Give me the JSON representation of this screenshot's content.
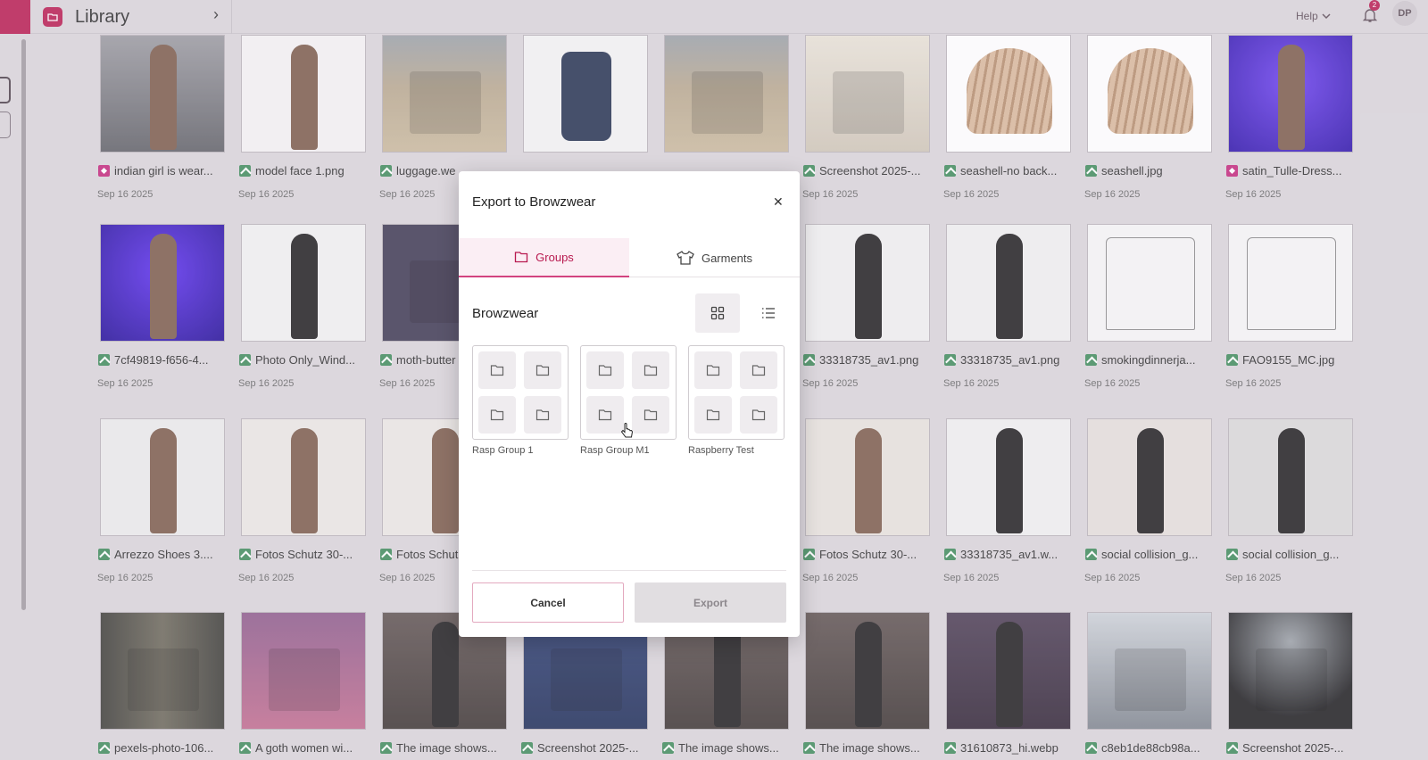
{
  "app": {
    "title": "Library",
    "help_label": "Help",
    "notifications_count": "2",
    "avatar_initials": "DP"
  },
  "grid": {
    "rows": [
      [
        {
          "name": "indian girl is wear...",
          "date": "Sep 16 2025",
          "tag": "pink",
          "thumb": "gym"
        },
        {
          "name": "model face 1.png",
          "date": "Sep 16 2025",
          "tag": "green",
          "thumb": "sport"
        },
        {
          "name": "luggage.we",
          "date": "Sep 16 2025",
          "tag": "green",
          "thumb": "rocks"
        },
        {
          "name": "",
          "date": "",
          "tag": "",
          "thumb": "suitcase"
        },
        {
          "name": "",
          "date": "",
          "tag": "",
          "thumb": "rocks"
        },
        {
          "name": "Screenshot 2025-...",
          "date": "Sep 16 2025",
          "tag": "green",
          "thumb": "room"
        },
        {
          "name": "seashell-no back...",
          "date": "Sep 16 2025",
          "tag": "green",
          "thumb": "shell"
        },
        {
          "name": "seashell.jpg",
          "date": "Sep 16 2025",
          "tag": "green",
          "thumb": "shell"
        },
        {
          "name": "satin_Tulle-Dress...",
          "date": "Sep 16 2025",
          "tag": "pink",
          "thumb": "purple"
        }
      ],
      [
        {
          "name": "7cf49819-f656-4...",
          "date": "Sep 16 2025",
          "tag": "green",
          "thumb": "bluecoat"
        },
        {
          "name": "Photo Only_Wind...",
          "date": "Sep 16 2025",
          "tag": "green",
          "thumb": "jacket"
        },
        {
          "name": "moth-butter",
          "date": "Sep 16 2025",
          "tag": "green",
          "thumb": "moth"
        },
        {
          "name": "",
          "date": "",
          "tag": "",
          "thumb": "hidden"
        },
        {
          "name": "",
          "date": "",
          "tag": "",
          "thumb": "hidden"
        },
        {
          "name": "33318735_av1.png",
          "date": "Sep 16 2025",
          "tag": "green",
          "thumb": "dress"
        },
        {
          "name": "33318735_av1.png",
          "date": "Sep 16 2025",
          "tag": "green",
          "thumb": "dress"
        },
        {
          "name": "smokingdinnerja...",
          "date": "Sep 16 2025",
          "tag": "green",
          "thumb": "sketch"
        },
        {
          "name": "FAO9155_MC.jpg",
          "date": "Sep 16 2025",
          "tag": "green",
          "thumb": "sketch"
        }
      ],
      [
        {
          "name": "Arrezzo Shoes 3....",
          "date": "Sep 16 2025",
          "tag": "green",
          "thumb": "redskirt"
        },
        {
          "name": "Fotos Schutz 30-...",
          "date": "Sep 16 2025",
          "tag": "green",
          "thumb": "heels"
        },
        {
          "name": "Fotos Schut",
          "date": "Sep 16 2025",
          "tag": "green",
          "thumb": "heels"
        },
        {
          "name": "",
          "date": "",
          "tag": "",
          "thumb": "hidden"
        },
        {
          "name": "",
          "date": "",
          "tag": "",
          "thumb": "hidden"
        },
        {
          "name": "Fotos Schutz 30-...",
          "date": "Sep 16 2025",
          "tag": "green",
          "thumb": "whitedress"
        },
        {
          "name": "33318735_av1.w...",
          "date": "Sep 16 2025",
          "tag": "green",
          "thumb": "dress"
        },
        {
          "name": "social collision_g...",
          "date": "Sep 16 2025",
          "tag": "green",
          "thumb": "hoodie"
        },
        {
          "name": "social collision_g...",
          "date": "Sep 16 2025",
          "tag": "green",
          "thumb": "sweater"
        }
      ],
      [
        {
          "name": "pexels-photo-106...",
          "date": "",
          "tag": "green",
          "thumb": "carpet"
        },
        {
          "name": "A goth women wi...",
          "date": "",
          "tag": "green",
          "thumb": "flowers"
        },
        {
          "name": "The image shows...",
          "date": "",
          "tag": "green",
          "thumb": "goth"
        },
        {
          "name": "Screenshot 2025-...",
          "date": "",
          "tag": "green",
          "thumb": "locker"
        },
        {
          "name": "The image shows...",
          "date": "",
          "tag": "green",
          "thumb": "goth"
        },
        {
          "name": "The image shows...",
          "date": "",
          "tag": "green",
          "thumb": "goth"
        },
        {
          "name": "31610873_hi.webp",
          "date": "",
          "tag": "green",
          "thumb": "goth2"
        },
        {
          "name": "c8eb1de88cb98a...",
          "date": "",
          "tag": "green",
          "thumb": "arches"
        },
        {
          "name": "Screenshot 2025-...",
          "date": "",
          "tag": "green",
          "thumb": "cathedral"
        }
      ]
    ]
  },
  "modal": {
    "title": "Export to Browzwear",
    "tabs": [
      {
        "label": "Groups",
        "active": true
      },
      {
        "label": "Garments",
        "active": false
      }
    ],
    "section_title": "Browzwear",
    "groups": [
      {
        "label": "Rasp Group 1"
      },
      {
        "label": "Rasp Group M1"
      },
      {
        "label": "Raspberry Test"
      }
    ],
    "cancel_label": "Cancel",
    "export_label": "Export"
  },
  "colors": {
    "accent": "#b8194f",
    "tag_green": "#3d8a5a",
    "tag_pink": "#c2267a",
    "background": "#d9d5da"
  }
}
